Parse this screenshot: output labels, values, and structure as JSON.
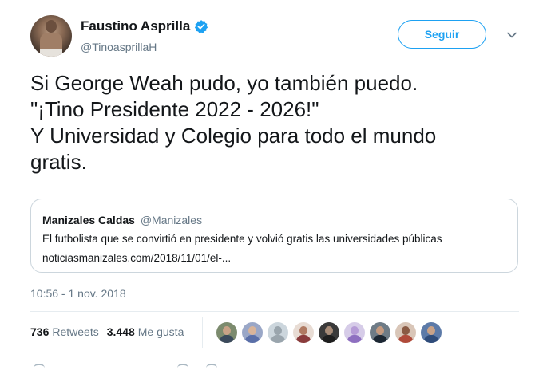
{
  "header": {
    "name": "Faustino Asprilla",
    "handle": "@TinoasprillaH",
    "follow_label": "Seguir",
    "verified_color": "#1da1f2"
  },
  "tweet": {
    "text": "Si George Weah pudo, yo también puedo.\n\"¡Tino Presidente 2022 - 2026!\"\nY Universidad y Colegio para todo el mundo\ngratis."
  },
  "quoted": {
    "name": "Manizales Caldas",
    "handle": "@Manizales",
    "text": "El futbolista que se convirtió en presidente y volvió gratis las universidades públicas",
    "link": "noticiasmanizales.com/2018/11/01/el-..."
  },
  "timestamp": "10:56 - 1 nov. 2018",
  "stats": {
    "retweets_count": "736",
    "retweets_label": "Retweets",
    "likes_count": "3.448",
    "likes_label": "Me gusta"
  },
  "liker_avatars": [
    {
      "bg": "#7c8b6e",
      "face": "#c9a287",
      "body": "#3b4a5c"
    },
    {
      "bg": "#9aa7c7",
      "face": "#d8b49a",
      "body": "#5a6fa8"
    },
    {
      "bg": "#ccd6dd",
      "face": "#9aa5ad",
      "body": "#9aa5ad"
    },
    {
      "bg": "#e8dcd4",
      "face": "#b07a62",
      "body": "#8a3c3c"
    },
    {
      "bg": "#3a3a3a",
      "face": "#a88c78",
      "body": "#1e1e1e"
    },
    {
      "bg": "#d6cce8",
      "face": "#b59bd6",
      "body": "#8e6fc0"
    },
    {
      "bg": "#6e7b86",
      "face": "#c49a80",
      "body": "#1c2733"
    },
    {
      "bg": "#d9c6b8",
      "face": "#8a5a44",
      "body": "#b04a3a"
    },
    {
      "bg": "#5c7aa8",
      "face": "#c8a288",
      "body": "#2f4c7a"
    }
  ]
}
